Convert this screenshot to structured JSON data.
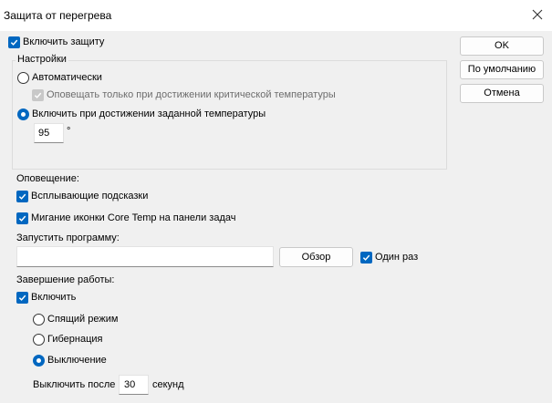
{
  "window": {
    "title": "Защита от перегрева"
  },
  "enable_protection": {
    "label": "Включить защиту",
    "checked": true
  },
  "settings_group": {
    "legend": "Настройки",
    "auto_label": "Автоматически",
    "notify_critical_label": "Оповещать только при достижении критической температуры",
    "custom_temp_label": "Включить при достижении заданной температуры",
    "temperature_value": "95",
    "degree_symbol": "°"
  },
  "notification": {
    "heading": "Оповещение:",
    "popups_label": "Всплывающие подсказки",
    "blink_label": "Мигание иконки Core Temp на панели задач"
  },
  "run_program": {
    "heading": "Запустить программу:",
    "path_value": "",
    "browse_label": "Обзор",
    "once_label": "Один раз"
  },
  "shutdown": {
    "heading": "Завершение работы:",
    "enable_label": "Включить",
    "sleep_label": "Спящий режим",
    "hibernate_label": "Гибернация",
    "poweroff_label": "Выключение",
    "after_label": "Выключить после",
    "after_value": "30",
    "unit_label": "секунд"
  },
  "buttons": {
    "ok": "OK",
    "default": "По умолчанию",
    "cancel": "Отмена"
  },
  "colors": {
    "accent": "#0067c0",
    "background": "#f0f0f0",
    "titlebar": "#ffffff"
  }
}
